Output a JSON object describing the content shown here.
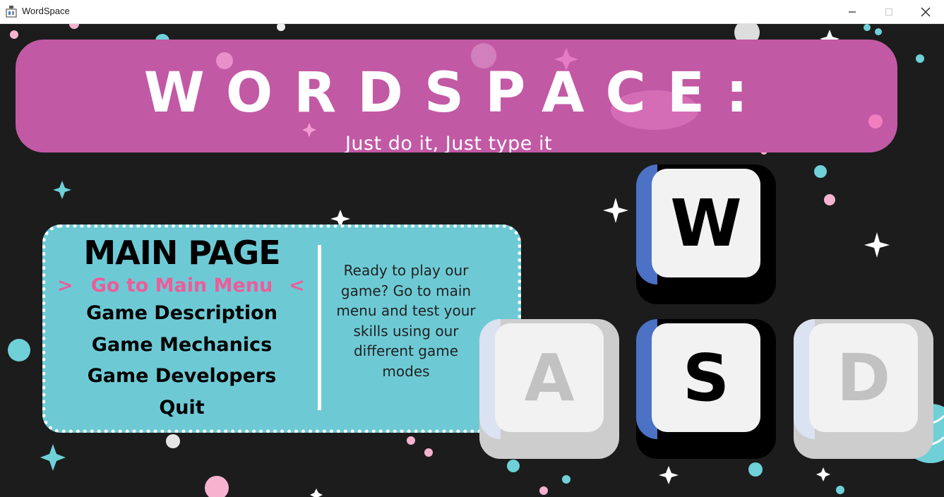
{
  "window": {
    "title": "WordSpace",
    "minimize_icon": "minimize-icon",
    "maximize_icon": "maximize-icon",
    "close_icon": "close-icon"
  },
  "header": {
    "title": "WORDSPACE:",
    "tagline": "Just do it, Just type it"
  },
  "menu": {
    "heading": "MAIN PAGE",
    "selection_left": ">",
    "selection_right": "<",
    "items": [
      {
        "label": "Go to Main Menu",
        "selected": true
      },
      {
        "label": "Game Description",
        "selected": false
      },
      {
        "label": "Game Mechanics",
        "selected": false
      },
      {
        "label": "Game Developers",
        "selected": false
      },
      {
        "label": "Quit",
        "selected": false
      }
    ],
    "description": "Ready to play our game? Go to main menu and test your skills using our different game modes"
  },
  "keys": [
    {
      "label": "W",
      "state": "pressed"
    },
    {
      "label": "A",
      "state": "idle"
    },
    {
      "label": "S",
      "state": "pressed"
    },
    {
      "label": "D",
      "state": "idle"
    }
  ],
  "colors": {
    "banner": "#c259a5",
    "panel": "#6dcad5",
    "highlight": "#ec5d99",
    "background": "#1c1c1c",
    "key_accent": "#4b72c5"
  }
}
